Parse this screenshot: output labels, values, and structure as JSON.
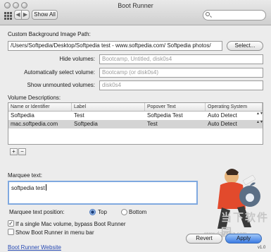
{
  "window": {
    "title": "Boot Runner"
  },
  "toolbar": {
    "show_all_label": "Show All",
    "back_glyph": "◀",
    "forward_glyph": "▶"
  },
  "background": {
    "label": "Custom Background Image Path:",
    "path_value": "/Users/Softpedia/Desktop/Softpedia test - www.softpedia.com/ Softpedia photos/",
    "select_button": "Select..."
  },
  "volumes": {
    "hide_label": "Hide volumes:",
    "hide_placeholder": "Bootcamp, Untitled, disk0s4",
    "auto_label": "Automatically select volume:",
    "auto_placeholder": "Bootcamp (or disk0s4)",
    "unmounted_label": "Show unmounted volumes:",
    "unmounted_placeholder": "disk0s4"
  },
  "descriptions": {
    "label": "Volume Descriptions:",
    "columns": [
      "Name or Identifier",
      "Label",
      "Popover Text",
      "Operating System"
    ],
    "rows": [
      [
        "Softpedia",
        "Test",
        "Softpedia Test",
        "Auto Detect"
      ],
      [
        "mac.softpedia.com",
        "Softpedia",
        "Test",
        "Auto Detect"
      ]
    ],
    "add_label": "+",
    "remove_label": "−",
    "stepper_glyph": "▲▼"
  },
  "marquee": {
    "label": "Marquee text:",
    "value": "softpedia test",
    "position_label": "Marquee text position:",
    "position_options": [
      "Top",
      "Bottom"
    ],
    "position_selected": "Top"
  },
  "options": {
    "bypass_label": "If a single Mac volume, bypass Boot Runner",
    "bypass_checked": true,
    "menubar_label": "Show Boot Runner in menu bar",
    "menubar_checked": false,
    "check_glyph": "✓"
  },
  "footer": {
    "website_link": "Boot Runner Website",
    "revert_button": "Revert",
    "apply_button": "Apply",
    "version": "v1.0"
  },
  "watermark": {
    "site": "www.downxia.com",
    "brand_cn": "当下软件园"
  },
  "colors": {
    "accent_blue": "#3c7be3",
    "link": "#2548b3",
    "selection_gray": "#d4d4d4"
  }
}
